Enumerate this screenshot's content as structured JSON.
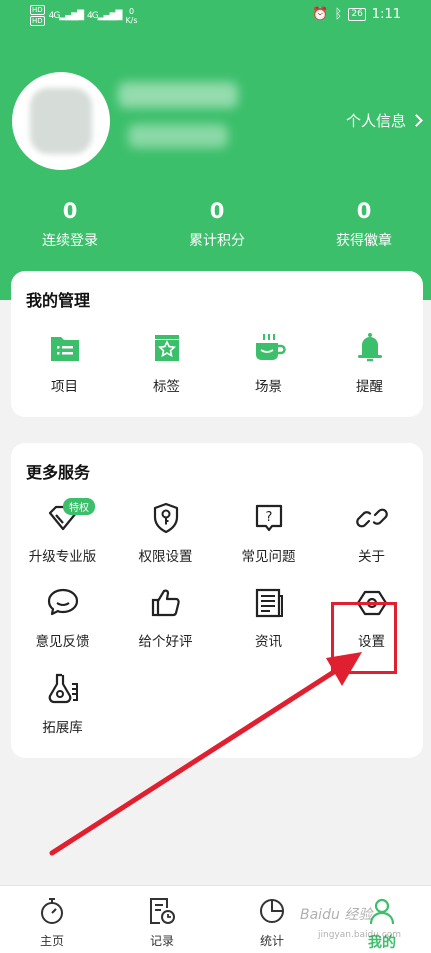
{
  "status_bar": {
    "hd1": "HD",
    "hd2": "HD",
    "signal1": "4G",
    "signal2": "4G",
    "speed_value": "0",
    "speed_unit": "K/s",
    "battery": "26",
    "time": "1:11"
  },
  "header": {
    "profile_link_label": "个人信息",
    "stats": [
      {
        "value": "0",
        "label": "连续登录"
      },
      {
        "value": "0",
        "label": "累计积分"
      },
      {
        "value": "0",
        "label": "获得徽章"
      }
    ]
  },
  "management": {
    "title": "我的管理",
    "items": [
      {
        "label": "项目",
        "icon": "folder-icon"
      },
      {
        "label": "标签",
        "icon": "bookmark-star-icon"
      },
      {
        "label": "场景",
        "icon": "coffee-cup-icon"
      },
      {
        "label": "提醒",
        "icon": "bell-icon"
      }
    ]
  },
  "services": {
    "title": "更多服务",
    "badge": "特权",
    "items": [
      {
        "label": "升级专业版",
        "icon": "diamond-icon"
      },
      {
        "label": "权限设置",
        "icon": "shield-key-icon"
      },
      {
        "label": "常见问题",
        "icon": "question-bubble-icon"
      },
      {
        "label": "关于",
        "icon": "link-icon"
      },
      {
        "label": "意见反馈",
        "icon": "chat-bubble-icon"
      },
      {
        "label": "给个好评",
        "icon": "thumbs-up-icon"
      },
      {
        "label": "资讯",
        "icon": "news-icon"
      },
      {
        "label": "设置",
        "icon": "hexagon-settings-icon"
      },
      {
        "label": "拓展库",
        "icon": "flask-icon"
      }
    ]
  },
  "tabbar": {
    "tabs": [
      {
        "label": "主页",
        "icon": "stopwatch-icon"
      },
      {
        "label": "记录",
        "icon": "record-clock-icon"
      },
      {
        "label": "统计",
        "icon": "pie-chart-icon"
      },
      {
        "label": "我的",
        "icon": "person-icon"
      }
    ],
    "active_index": 3
  },
  "watermark": {
    "text": "Baidu 经验",
    "sub": "jingyan.baidu.com"
  },
  "colors": {
    "brand_green": "#3cbf6b",
    "annotation_red": "#e02030"
  }
}
